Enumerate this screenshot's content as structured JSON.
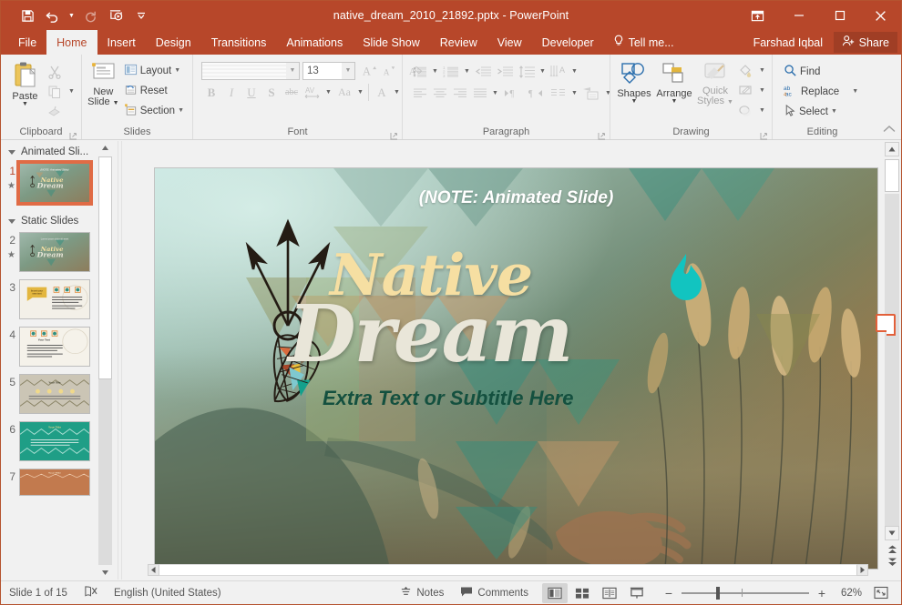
{
  "window": {
    "title": "native_dream_2010_21892.pptx - PowerPoint",
    "minimize_label": "–",
    "maximize_label": "□",
    "close_label": "✕",
    "ribbon_display_options": "ribbon-display-options"
  },
  "quick_access": [
    {
      "name": "save",
      "label": "Save"
    },
    {
      "name": "undo",
      "label": "Undo"
    },
    {
      "name": "redo",
      "label": "Redo"
    },
    {
      "name": "start-from-beginning",
      "label": "Start From Beginning"
    },
    {
      "name": "customize-qat",
      "label": "Customize Quick Access Toolbar"
    }
  ],
  "tabs": [
    {
      "label": "File",
      "active": false
    },
    {
      "label": "Home",
      "active": true
    },
    {
      "label": "Insert",
      "active": false
    },
    {
      "label": "Design",
      "active": false
    },
    {
      "label": "Transitions",
      "active": false
    },
    {
      "label": "Animations",
      "active": false
    },
    {
      "label": "Slide Show",
      "active": false
    },
    {
      "label": "Review",
      "active": false
    },
    {
      "label": "View",
      "active": false
    },
    {
      "label": "Developer",
      "active": false
    }
  ],
  "tellme": {
    "label": "Tell me..."
  },
  "account": {
    "name": "Farshad Iqbal"
  },
  "share": {
    "label": "Share"
  },
  "ribbon": {
    "groups": [
      {
        "label": "Clipboard"
      },
      {
        "label": "Slides"
      },
      {
        "label": "Font"
      },
      {
        "label": "Paragraph"
      },
      {
        "label": "Drawing"
      },
      {
        "label": "Editing"
      }
    ],
    "clipboard": {
      "paste_label": "Paste",
      "cut_label": "Cut",
      "copy_label": "Copy",
      "format_painter_label": "Format Painter"
    },
    "slides": {
      "new_slide_line1": "New",
      "new_slide_line2": "Slide",
      "layout_label": "Layout",
      "reset_label": "Reset",
      "section_label": "Section"
    },
    "font": {
      "font_name_value": "",
      "font_name_placeholder": "",
      "font_size_value": "13",
      "increase_size_label": "A",
      "decrease_size_label": "A",
      "clear_formatting_label": "Clear All Formatting",
      "bold_label": "B",
      "italic_label": "I",
      "underline_label": "U",
      "shadow_label": "S",
      "strikethrough_label": "abc",
      "spacing_label": "AV",
      "change_case_label": "Aa",
      "font_color_label": "A"
    },
    "paragraph": {
      "bullets_label": "Bullets",
      "numbering_label": "Numbering",
      "decrease_indent_label": "Decrease List Level",
      "increase_indent_label": "Increase List Level",
      "line_spacing_label": "Line Spacing",
      "text_direction_label": "Text Direction",
      "align_text_label": "Align Text",
      "convert_smartart_label": "Convert to SmartArt",
      "align_left_label": "Align Left",
      "center_label": "Center",
      "align_right_label": "Align Right",
      "justify_label": "Justify",
      "ltr_label": "Left-to-Right",
      "rtl_label": "Right-to-Left",
      "columns_label": "Columns"
    },
    "drawing": {
      "shapes_label": "Shapes",
      "arrange_label": "Arrange",
      "quick_styles_line1": "Quick",
      "quick_styles_line2": "Styles",
      "shape_fill_label": "Shape Fill",
      "shape_outline_label": "Shape Outline",
      "shape_effects_label": "Shape Effects"
    },
    "editing": {
      "find_label": "Find",
      "replace_label": "Replace",
      "select_label": "Select"
    },
    "collapse_label": "Collapse the Ribbon"
  },
  "slide_panel": {
    "sections": [
      {
        "title": "Animated Sli...",
        "slides": [
          {
            "number": "1",
            "selected": true,
            "animated": true
          }
        ]
      },
      {
        "title": "Static Slides",
        "slides": [
          {
            "number": "2",
            "selected": false,
            "animated": true
          },
          {
            "number": "3",
            "selected": false,
            "animated": false
          },
          {
            "number": "4",
            "selected": false,
            "animated": false
          },
          {
            "number": "5",
            "selected": false,
            "animated": false
          },
          {
            "number": "6",
            "selected": false,
            "animated": false
          },
          {
            "number": "7",
            "selected": false,
            "animated": false
          }
        ]
      }
    ],
    "anim_glyph": "★"
  },
  "slide": {
    "note_text": "(NOTE: Animated Slide)",
    "title_word1": "Native",
    "title_word2": "Dream",
    "subtitle": "Extra Text or Subtitle Here",
    "colors": {
      "word1": "#f6dfa2",
      "word2": "#e9e6d9",
      "subtitle": "#14503f",
      "flame": "#12c4c0",
      "chevron_tan": "#c99a6a",
      "chevron_teal": "#2f8f7f",
      "chevron_olive": "#8a8a4a"
    }
  },
  "status": {
    "slide_counter": "Slide 1 of 15",
    "spellcheck_label": "Spelling Check",
    "language": "English (United States)",
    "notes_label": "Notes",
    "comments_label": "Comments",
    "views": [
      {
        "name": "normal-view",
        "label": "Normal",
        "active": true
      },
      {
        "name": "slide-sorter-view",
        "label": "Slide Sorter",
        "active": false
      },
      {
        "name": "reading-view",
        "label": "Reading View",
        "active": false
      },
      {
        "name": "slide-show-view",
        "label": "Slide Show",
        "active": false
      }
    ],
    "zoom_out_label": "−",
    "zoom_in_label": "+",
    "zoom_percent": "62%",
    "fit_label": "Fit slide to current window"
  }
}
